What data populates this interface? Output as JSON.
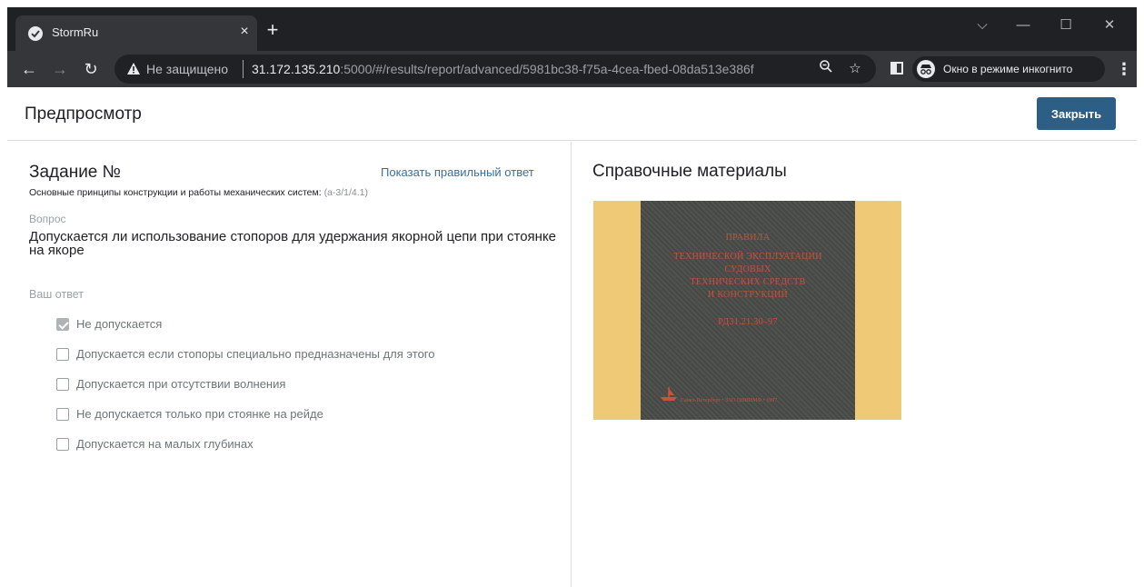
{
  "browser": {
    "tab_title": "StormRu",
    "tab_close": "×",
    "new_tab": "+",
    "security_label": "Не защищено",
    "url_host": "31.172.135.210",
    "url_rest": ":5000/#/results/report/advanced/5981bc38-f75a-4cea-fbed-08da513e386f",
    "incognito_label": "Окно в режиме инкогнито",
    "window_controls": {
      "dropdown": "⌵",
      "minimize": "—",
      "maximize": "☐",
      "close": "✕"
    },
    "nav": {
      "back": "←",
      "forward": "→",
      "reload": "↻"
    },
    "icons": [
      "warning-icon",
      "zoom-icon",
      "star-icon",
      "side-panel-icon",
      "incognito-icon",
      "menu-icon"
    ]
  },
  "header": {
    "title": "Предпросмотр",
    "close_label": "Закрыть"
  },
  "task": {
    "title": "Задание №",
    "show_answer_label": "Показать правильный ответ",
    "subtitle": "Основные принципы конструкции и работы механических систем:",
    "subtitle_code": "(а-3/1/4.1)",
    "question_label": "Вопрос",
    "question_text": "Допускается ли использование стопоров для удержания якорной цепи при стоянке на якоре",
    "answer_label": "Ваш ответ",
    "options": [
      {
        "label": "Не допускается",
        "checked": true
      },
      {
        "label": "Допускается если стопоры специально предназначены для этого",
        "checked": false
      },
      {
        "label": "Допускается при отсутствии волнения",
        "checked": false
      },
      {
        "label": "Не допускается только при стоянке на рейде",
        "checked": false
      },
      {
        "label": "Допускается на малых глубинах",
        "checked": false
      }
    ]
  },
  "reference": {
    "title": "Справочные материалы",
    "book": {
      "lines": [
        "ПРАВИЛА",
        "ТЕХНИЧЕСКОЙ ЭКСПЛУАТАЦИИ",
        "СУДОВЫХ",
        "ТЕХНИЧЕСКИХ СРЕДСТВ",
        "И КОНСТРУКЦИЙ",
        "РД31.21.30–97"
      ],
      "publisher": "Санкт-Петербург • ЗАО ЦНИИМФ • 1997"
    }
  },
  "colors": {
    "accent": "#2d5f86",
    "link": "#3d6f99",
    "book_bg": "#f0c977",
    "book_cover": "#4a4c49",
    "book_text": "#c8523a"
  }
}
